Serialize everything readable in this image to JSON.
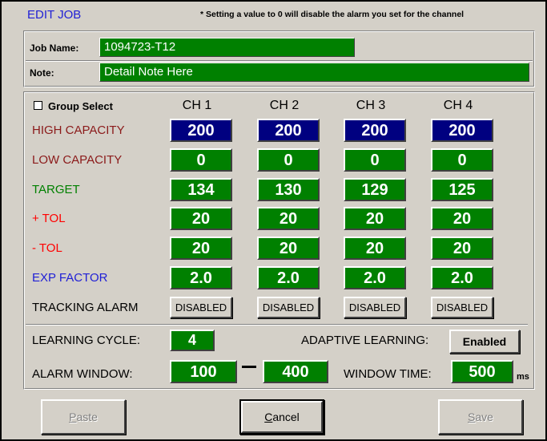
{
  "title": "EDIT JOB",
  "hint": "* Setting a value to 0 will disable the alarm you set for the channel",
  "job": {
    "name_label": "Job Name:",
    "name_value": "1094723-T12",
    "note_label": "Note:",
    "note_value": "Detail Note Here"
  },
  "group_select": {
    "label": "Group Select",
    "checked": false
  },
  "channels": [
    "CH 1",
    "CH 2",
    "CH 3",
    "CH 4"
  ],
  "rows": [
    {
      "label": "HIGH CAPACITY",
      "color": "#8b1a1a",
      "style": "blue",
      "values": [
        "200",
        "200",
        "200",
        "200"
      ]
    },
    {
      "label": "LOW CAPACITY",
      "color": "#8b1a1a",
      "style": "green",
      "values": [
        "0",
        "0",
        "0",
        "0"
      ]
    },
    {
      "label": "TARGET",
      "color": "#008000",
      "style": "green",
      "values": [
        "134",
        "130",
        "129",
        "125"
      ]
    },
    {
      "label": "+ TOL",
      "color": "#ff0000",
      "style": "green",
      "values": [
        "20",
        "20",
        "20",
        "20"
      ]
    },
    {
      "label": "- TOL",
      "color": "#ff0000",
      "style": "green",
      "values": [
        "20",
        "20",
        "20",
        "20"
      ]
    },
    {
      "label": "EXP FACTOR",
      "color": "#1f1fd6",
      "style": "green",
      "values": [
        "2.0",
        "2.0",
        "2.0",
        "2.0"
      ]
    }
  ],
  "tracking": {
    "label": "TRACKING ALARM",
    "buttons": [
      "DISABLED",
      "DISABLED",
      "DISABLED",
      "DISABLED"
    ]
  },
  "learning": {
    "cycle_label": "LEARNING CYCLE:",
    "cycle_value": "4",
    "adaptive_label": "ADAPTIVE LEARNING:",
    "adaptive_button": "Enabled"
  },
  "alarm_window": {
    "label": "ALARM WINDOW:",
    "low": "100",
    "high": "400",
    "time_label": "WINDOW TIME:",
    "time_value": "500",
    "time_unit": "ms"
  },
  "buttons": {
    "paste": {
      "label": "Paste",
      "accel": "P",
      "rest": "aste"
    },
    "cancel": {
      "label": "Cancel",
      "accel": "C",
      "rest": "ancel"
    },
    "save": {
      "label": "Save",
      "accel": "S",
      "rest": "ave"
    }
  }
}
